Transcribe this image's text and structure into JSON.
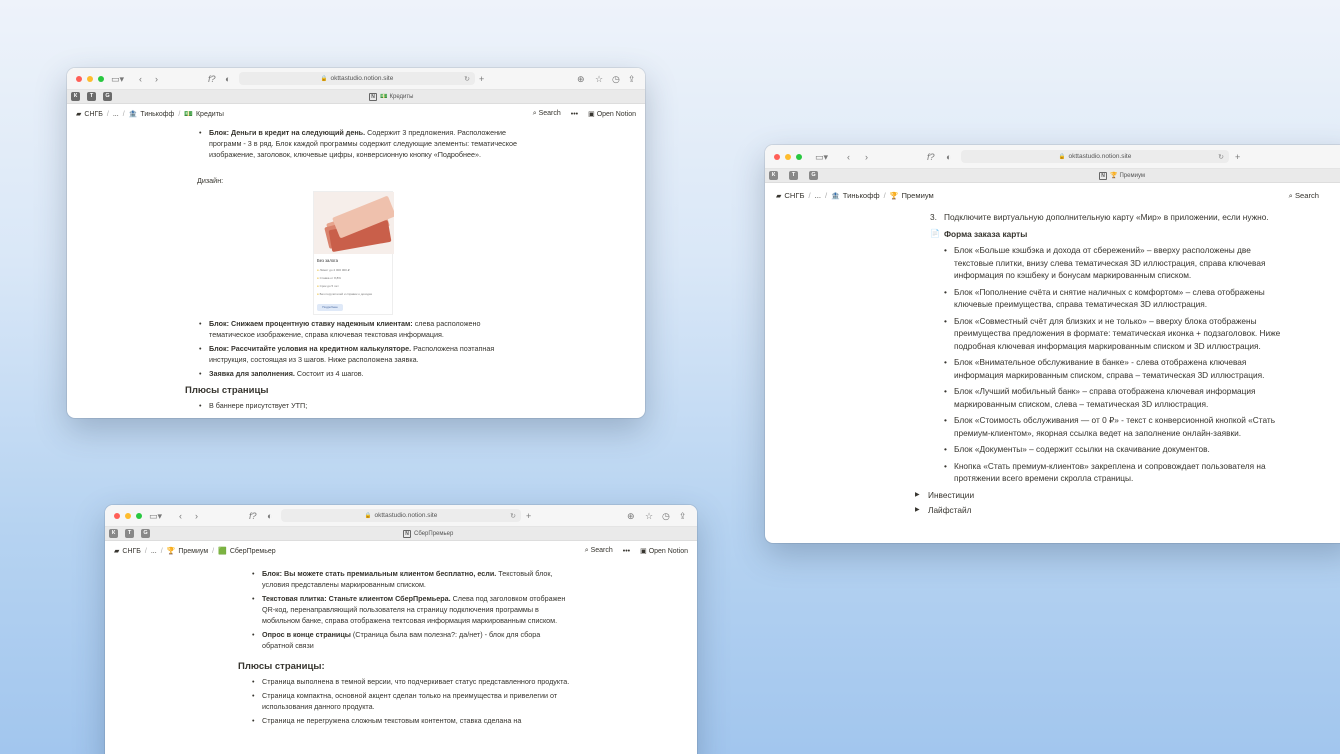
{
  "window1": {
    "url": "okttastudio.notion.site",
    "tab_title": "Кредиты",
    "tab_icon": "💵",
    "breadcrumb": [
      "СНГБ",
      "...",
      "Тинькофф",
      "Кредиты"
    ],
    "breadcrumb_icons": [
      "🏠",
      "",
      "🏦",
      "💵"
    ],
    "search_label": "Search",
    "more_label": "•••",
    "open_label": "Open Notion",
    "block1_bold": "Блок: Деньги в кредит на следующий день.",
    "block1_text": " Содержит 3 предложения. Расположение программ - 3 в ряд. Блок каждой программы содержит следующие элементы: тематическое изображение, заголовок, ключевые цифры, конверсионную кнопку «Подробнее».",
    "design_label": "Дизайн:",
    "card": {
      "title": "Без залога",
      "lines": [
        "Лимит до 2 000 000 ₽",
        "Ставка от 8,8%",
        "Срок до 5 лет",
        "Без поручителей и справок о доходах"
      ],
      "button": "Подробнее"
    },
    "items": [
      {
        "bold": "Блок: Снижаем процентную ставку надежным клиентам:",
        "text": " слева расположено тематическое изображение, справа ключевая текстовая информация."
      },
      {
        "bold": "Блок: Рассчитайте условия на кредитном калькуляторе.",
        "text": " Расположена поэтапная инструкция, состоящая из 3 шагов. Ниже расположена заявка."
      },
      {
        "bold": "Заявка для заполнения.",
        "text": " Состоит из 4 шагов."
      }
    ],
    "heading": "Плюсы страницы",
    "plus_item": "В баннере присутствует УТП;"
  },
  "window2": {
    "url": "okttastudio.notion.site",
    "tab_title": "СберПремьер",
    "breadcrumb": [
      "СНГБ",
      "...",
      "Премиум",
      "СберПремьер"
    ],
    "breadcrumb_icons": [
      "🏠",
      "",
      "🏆",
      "🟩"
    ],
    "search_label": "Search",
    "more_label": "•••",
    "open_label": "Open Notion",
    "items": [
      {
        "bold": "Блок: Вы можете стать премиальным клиентом бесплатно, если.",
        "text": " Текстовый блок, условия представлены маркированным списком."
      },
      {
        "bold": "Текстовая плитка: Станьте клиентом СберПремьера.",
        "text": " Слева под заголовком отображен QR-код, перенаправляющий пользователя на страницу подключения программы в мобильном банке, справа отображена тектсовая информация маркированным списком."
      },
      {
        "bold": "Опрос в конце страницы",
        "text": " (Страница была вам полезна?: да/нет) - блок для сбора обратной связи"
      }
    ],
    "heading": "Плюсы страницы:",
    "plus_items": [
      "Страница выполнена в темной версии, что подчеркивает статус представленного продукта.",
      "Страница компактна, основной акцент сделан только на преимущества и привелегии от использования данного продукта.",
      "Страница не перегружена сложным текстовым контентом, ставка сделана на"
    ]
  },
  "window3": {
    "url": "okttastudio.notion.site",
    "tab_title": "Премиум",
    "tab_icon": "🏆",
    "breadcrumb": [
      "СНГБ",
      "...",
      "Тинькофф",
      "Премиум"
    ],
    "breadcrumb_icons": [
      "🏠",
      "",
      "🏦",
      "🏆"
    ],
    "search_label": "Search",
    "numbered_no": "3.",
    "numbered_text": "Подключите виртуальную дополнительную карту «Мир» в приложении, если нужно.",
    "subheading": "Форма заказа карты",
    "items": [
      "Блок «Больше кэшбэка и дохода от сбережений» – вверху расположены две текстовые плитки, внизу слева тематическая 3D иллюстрация, справа ключевая информация по кэшбеку и бонусам маркированным списком.",
      "Блок «Пополнение счёта и снятие наличных с комфортом» – слева отображены ключевые преимущества, справа тематическая 3D иллюстрация.",
      "Блок «Совместный счёт для близких и не только» – вверху блока отображены преимущества предложения в формате: тематическая иконка + подзаголовок. Ниже подробная ключевая информация маркированным списком и 3D иллюстрация.",
      "Блок «Внимательное обслуживание в банке» - слева отображена ключевая информация маркированным списком, справа – тематическая 3D иллюстрация.",
      "Блок «Лучший мобильный банк» – справа отображена ключевая информация маркированным списком, слева – тематическая 3D иллюстрация.",
      "Блок «Стоимость обслуживания — от 0 ₽» - текст с конверсионной кнопкой «Стать премиум-клиентом», якорная ссылка ведет на заполнение онлайн-заявки.",
      "Блок «Документы» – содержит ссылки на скачивание документов.",
      "Кнопка «Стать премиум-клиентов» закреплена и сопровождает пользователя на протяжении всего времени скролла страницы."
    ],
    "toggles": [
      "Инвестиции",
      "Лайфстайл"
    ]
  },
  "tab_favicons": [
    "К",
    "Т",
    "G"
  ],
  "colors": {
    "close": "#ff5f57",
    "minimize": "#febc2e",
    "zoom": "#28c840"
  }
}
